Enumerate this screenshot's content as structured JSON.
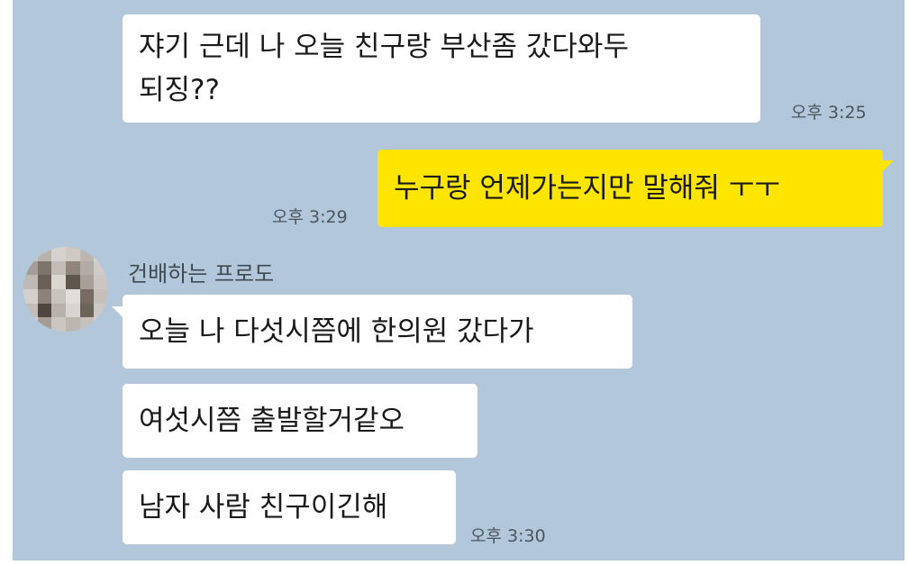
{
  "colors": {
    "chat_background": "#b2c7d9",
    "incoming_bubble": "#ffffff",
    "outgoing_bubble": "#fee500"
  },
  "messages": [
    {
      "direction": "incoming",
      "lines": [
        "쟈기 근데 나 오늘 친구랑 부산좀 갔다와두",
        "되징??"
      ],
      "time": "오후 3:25"
    },
    {
      "direction": "outgoing",
      "lines": [
        "누구랑 언제가는지만 말해줘 ㅜㅜ"
      ],
      "time": "오후 3:29"
    },
    {
      "direction": "incoming",
      "sender": "건배하는 프로도",
      "lines": [
        "오늘 나 다섯시쯤에 한의원 갔다가"
      ]
    },
    {
      "direction": "incoming",
      "lines": [
        "여섯시쯤 출발할거같오"
      ]
    },
    {
      "direction": "incoming",
      "lines": [
        "남자 사람 친구이긴해"
      ],
      "time": "오후 3:30"
    }
  ],
  "avatar": {
    "icon": "pixelated-profile-avatar",
    "pixel_colors": [
      "#c8c3bf",
      "#b8b2ad",
      "#d6d2cf",
      "#cfc9c4",
      "#bdb6b0",
      "#d9d5d2",
      "#a59e98",
      "#7d746c",
      "#c2bcb6",
      "#8f857c",
      "#b3aca6",
      "#d0cbc7",
      "#bfb9b3",
      "#6a6057",
      "#dad6d2",
      "#5f564e",
      "#a79f98",
      "#cbc6c2",
      "#d4d0cc",
      "#8b8279",
      "#c9c3be",
      "#e0ddda",
      "#766c63",
      "#c6c0bb",
      "#c3bdb8",
      "#4d453e",
      "#b8b1ab",
      "#d8d4d1",
      "#6c635b",
      "#cdc8c4",
      "#d2cdca",
      "#a49c95",
      "#cbc6c2",
      "#bcb6b0",
      "#c7c1bc",
      "#d5d1ce"
    ]
  }
}
